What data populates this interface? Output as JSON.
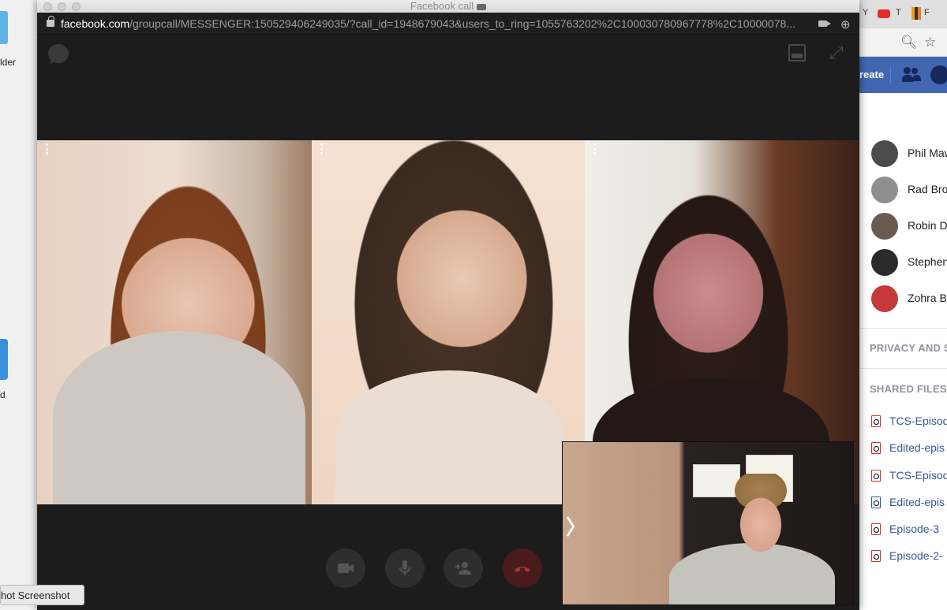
{
  "desktop": {
    "folder_label": "lder",
    "app_label": "d",
    "tooltip": "hot Screenshot"
  },
  "call_window": {
    "title": "Facebook call",
    "url_domain": "facebook.com",
    "url_rest": "/groupcall/MESSENGER:150529406249035/?call_id=1948679043&users_to_ring=1055763202%2C100030780967778%2C10000078..."
  },
  "browser": {
    "tab_letters": [
      "Y",
      "T",
      "F"
    ],
    "fb_create": "reate",
    "people": [
      {
        "name": "Phil Maw",
        "color": "#4b4b4b"
      },
      {
        "name": "Rad Bro",
        "color": "#8f8f8f"
      },
      {
        "name": "Robin D",
        "color": "#6b5a52"
      },
      {
        "name": "Stephen",
        "color": "#2b2b2b"
      },
      {
        "name": "Zohra B",
        "color": "#c43a3a"
      }
    ],
    "privacy_title": "PRIVACY AND S",
    "shared_files_title": "SHARED FILES",
    "files": [
      {
        "name": "TCS-Episod",
        "type": "pdf"
      },
      {
        "name": "Edited-epis",
        "type": "pdf"
      },
      {
        "name": "TCS-Episod",
        "type": "pdf"
      },
      {
        "name": "Edited-epis",
        "type": "doc"
      },
      {
        "name": "Episode-3",
        "type": "pdf"
      },
      {
        "name": "Episode-2-",
        "type": "pdf"
      }
    ]
  },
  "colors": {
    "facebook_blue": "#4267b2",
    "call_bg": "#1c1c1c",
    "link": "#385898"
  }
}
